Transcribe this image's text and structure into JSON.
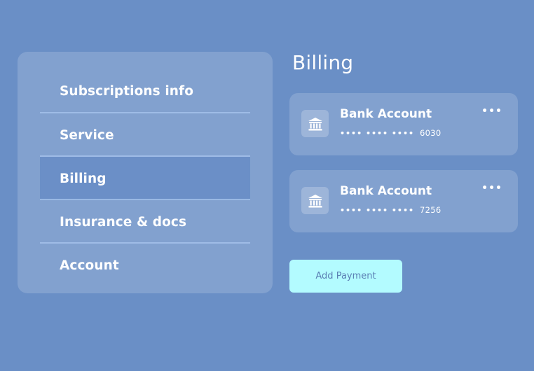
{
  "sidebar": {
    "items": [
      {
        "label": "Subscriptions info"
      },
      {
        "label": "Service"
      },
      {
        "label": "Billing",
        "active": true
      },
      {
        "label": "Insurance & docs"
      },
      {
        "label": "Account"
      }
    ]
  },
  "main": {
    "title": "Billing",
    "accounts": [
      {
        "name": "Bank Account",
        "masked": "•••• •••• ••••",
        "last4": "6030",
        "icon": "bank-icon"
      },
      {
        "name": "Bank Account",
        "masked": "•••• •••• ••••",
        "last4": "7256",
        "icon": "bank-icon"
      }
    ],
    "more_label": "•••",
    "add_payment_label": "Add Payment"
  },
  "colors": {
    "background": "#6a8fc6",
    "active_item": "#6b8fc7",
    "button_bg": "#b3fbff",
    "button_text": "#5b7fb4"
  }
}
